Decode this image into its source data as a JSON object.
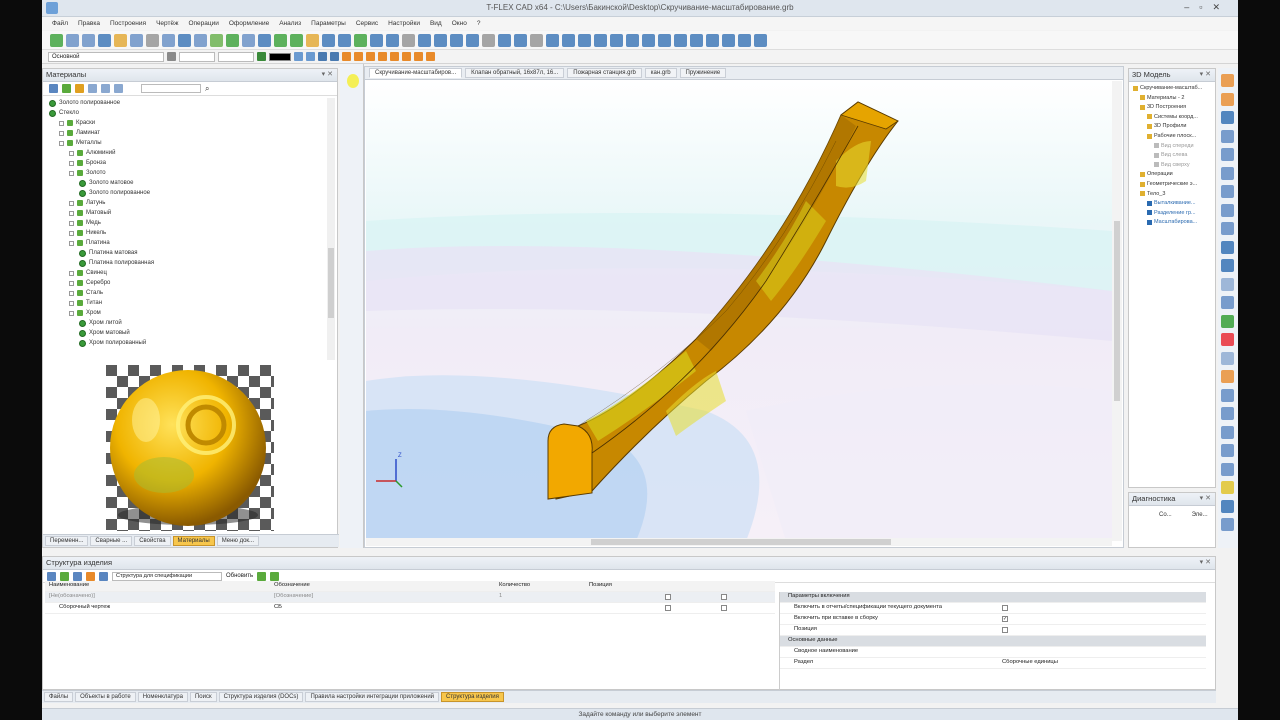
{
  "window": {
    "title": "T-FLEX CAD x64 - C:\\Users\\Бакинской\\Desktop\\Скручивание-масштабирование.grb"
  },
  "menu": [
    "Файл",
    "Правка",
    "Построения",
    "Чертёж",
    "Операции",
    "Оформление",
    "Анализ",
    "Параметры",
    "Сервис",
    "Настройки",
    "Вид",
    "Окно",
    "?"
  ],
  "toolbar2": {
    "layer": "Основной",
    "scale_a": "0",
    "scale_b": "0"
  },
  "materials": {
    "title": "Материалы",
    "tree": [
      {
        "label": "Золото полированное",
        "level": 0,
        "kind": "mat"
      },
      {
        "label": "Стекло",
        "level": 0,
        "kind": "mat"
      },
      {
        "label": "Краски",
        "level": 1,
        "kind": "folder"
      },
      {
        "label": "Ламинат",
        "level": 1,
        "kind": "folder"
      },
      {
        "label": "Металлы",
        "level": 1,
        "kind": "folder"
      },
      {
        "label": "Алюминий",
        "level": 2,
        "kind": "folder"
      },
      {
        "label": "Бронза",
        "level": 2,
        "kind": "folder"
      },
      {
        "label": "Золото",
        "level": 2,
        "kind": "folder"
      },
      {
        "label": "Золото матовое",
        "level": 3,
        "kind": "mat"
      },
      {
        "label": "Золото полированное",
        "level": 3,
        "kind": "mat"
      },
      {
        "label": "Латунь",
        "level": 2,
        "kind": "folder"
      },
      {
        "label": "Матовый",
        "level": 2,
        "kind": "folder"
      },
      {
        "label": "Медь",
        "level": 2,
        "kind": "folder"
      },
      {
        "label": "Никель",
        "level": 2,
        "kind": "folder"
      },
      {
        "label": "Платина",
        "level": 2,
        "kind": "folder"
      },
      {
        "label": "Платина матовая",
        "level": 3,
        "kind": "mat"
      },
      {
        "label": "Платина полированная",
        "level": 3,
        "kind": "mat"
      },
      {
        "label": "Свинец",
        "level": 2,
        "kind": "folder"
      },
      {
        "label": "Серебро",
        "level": 2,
        "kind": "folder"
      },
      {
        "label": "Сталь",
        "level": 2,
        "kind": "folder"
      },
      {
        "label": "Титан",
        "level": 2,
        "kind": "folder"
      },
      {
        "label": "Хром",
        "level": 2,
        "kind": "folder"
      },
      {
        "label": "Хром литой",
        "level": 3,
        "kind": "mat"
      },
      {
        "label": "Хром матовый",
        "level": 3,
        "kind": "mat"
      },
      {
        "label": "Хром полированный",
        "level": 3,
        "kind": "mat"
      }
    ],
    "tabs": [
      "Переменн...",
      "Сварные ...",
      "Свойства",
      "Материалы",
      "Меню док..."
    ],
    "active_tab": "Материалы"
  },
  "documents": {
    "tabs": [
      "Скручивание-масштабиров...",
      "Клапан обратный, 16х87л, 16...",
      "Пожарная станция.grb",
      "кан.grb",
      "Пружинение"
    ],
    "active": 0
  },
  "model3d": {
    "title": "3D Модель",
    "tree": [
      "Скручивание-масштаб...",
      "Материалы - 2",
      "3D Построения",
      "Системы коорд...",
      "3D Профили",
      "Рабочие плоск...",
      "Вид спереди",
      "Вид слева",
      "Вид сверху",
      "Операции",
      "Геометрические э...",
      "Тело_3",
      "Выталкивание...",
      "Разделение гр...",
      "Масштабирова..."
    ]
  },
  "diagnostics": {
    "title": "Диагностика",
    "cols": [
      "Со...",
      "Эле..."
    ]
  },
  "structure": {
    "title": "Структура изделия",
    "config_select": "Структура для спецификации",
    "refresh": "Обновить",
    "columns": [
      "Наименование",
      "Обозначение",
      "Количество",
      "Позиция"
    ],
    "rows": [
      {
        "name": "[Не(обозначено)]",
        "designation": "[Обозначение]",
        "qty": "1",
        "pos": ""
      },
      {
        "name": "Сборочный чертеж",
        "designation": "СБ",
        "qty": "",
        "pos": ""
      }
    ],
    "props": {
      "section1": "Параметры включения",
      "items1": [
        {
          "label": "Включить в отчеты/спецификации текущего документа",
          "checked": false
        },
        {
          "label": "Включить при вставке в сборку",
          "checked": true
        },
        {
          "label": "Позиция",
          "checked": false
        }
      ],
      "section2": "Основные данные",
      "items2": [
        {
          "label": "Сводное наименование",
          "value": ""
        },
        {
          "label": "Раздел",
          "value": "Сборочные единицы"
        }
      ]
    }
  },
  "bottom_tabs": [
    "Файлы",
    "Объекты в работе",
    "Номенклатура",
    "Поиск",
    "Структура изделия (DOCs)",
    "Правила настройки интеграции приложений",
    "Структура изделия"
  ],
  "bottom_active": "Структура изделия",
  "status": "Задайте команду или выберите элемент"
}
